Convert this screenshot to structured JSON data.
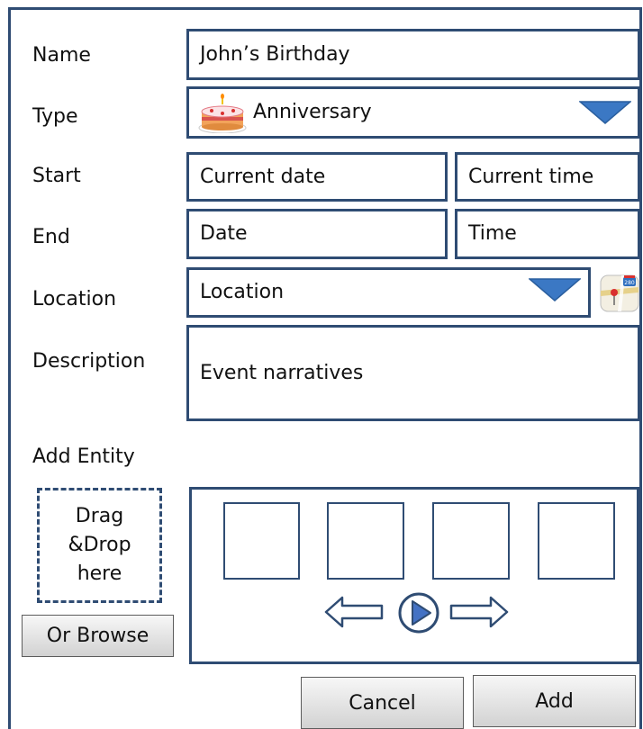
{
  "form": {
    "name": {
      "label": "Name",
      "value": "John’s Birthday"
    },
    "type": {
      "label": "Type",
      "value": "Anniversary",
      "icon": "cake-icon"
    },
    "start": {
      "label": "Start",
      "date": "Current date",
      "time": "Current time"
    },
    "end": {
      "label": "End",
      "date": "Date",
      "time": "Time"
    },
    "location": {
      "label": "Location",
      "value": "Location",
      "icon": "map-icon"
    },
    "description": {
      "label": "Description",
      "value": "Event narratives"
    },
    "entity": {
      "label": "Add Entity",
      "drop_line1": "Drag",
      "drop_line2": "&Drop",
      "drop_line3": "here",
      "browse_label": "Or Browse",
      "slot_count": 4
    }
  },
  "actions": {
    "cancel_label": "Cancel",
    "add_label": "Add"
  },
  "colors": {
    "accent": "#2F4C73",
    "dropdown_arrow": "#3B78C4",
    "button_bg": "#E0E0E0"
  }
}
